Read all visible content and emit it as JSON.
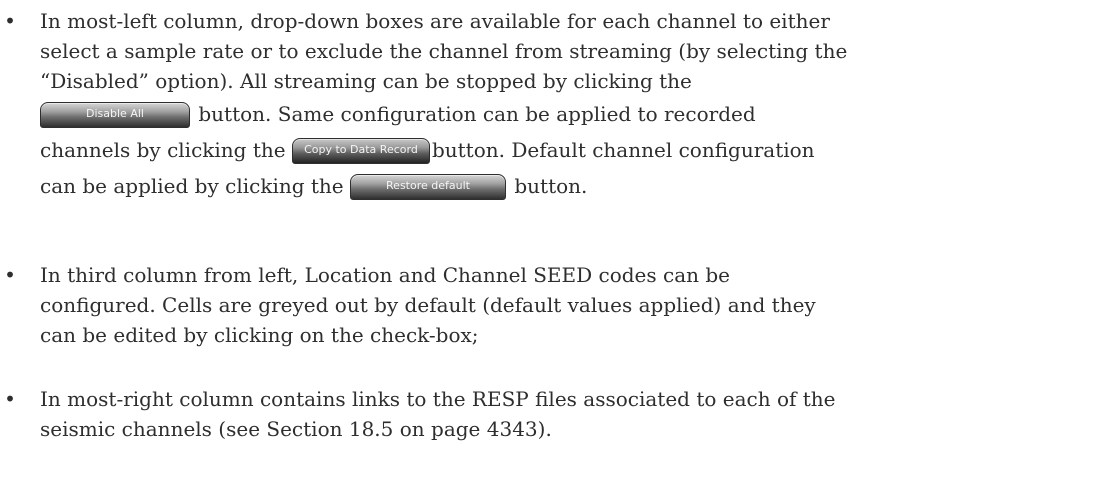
{
  "bullets": [
    {
      "lines": [
        "In most-left column, drop-down boxes are available for each channel to either",
        "select a sample rate or to exclude the channel from streaming (by selecting the",
        "“Disabled” option). All streaming can be stopped by clicking the"
      ],
      "disable_all_button": "Disable All",
      "after_disable_all": "button. Same configuration can be applied to recorded",
      "before_copy": "channels by clicking the",
      "copy_button": "Copy to Data Record",
      "after_copy": "button. Default channel configuration",
      "before_restore": "can be applied by clicking the",
      "restore_button": "Restore default",
      "after_restore": "button."
    },
    {
      "lines": [
        "In third column from left, Location and Channel SEED codes can be",
        "configured. Cells are greyed out by default (default values applied) and they",
        "can be edited by clicking on the check-box;"
      ]
    },
    {
      "lines": [
        "In most-right column contains links to the RESP files associated to each of the",
        "seismic channels (see Section 18.5 on page 4343)."
      ]
    }
  ],
  "bullet_symbol": "•"
}
